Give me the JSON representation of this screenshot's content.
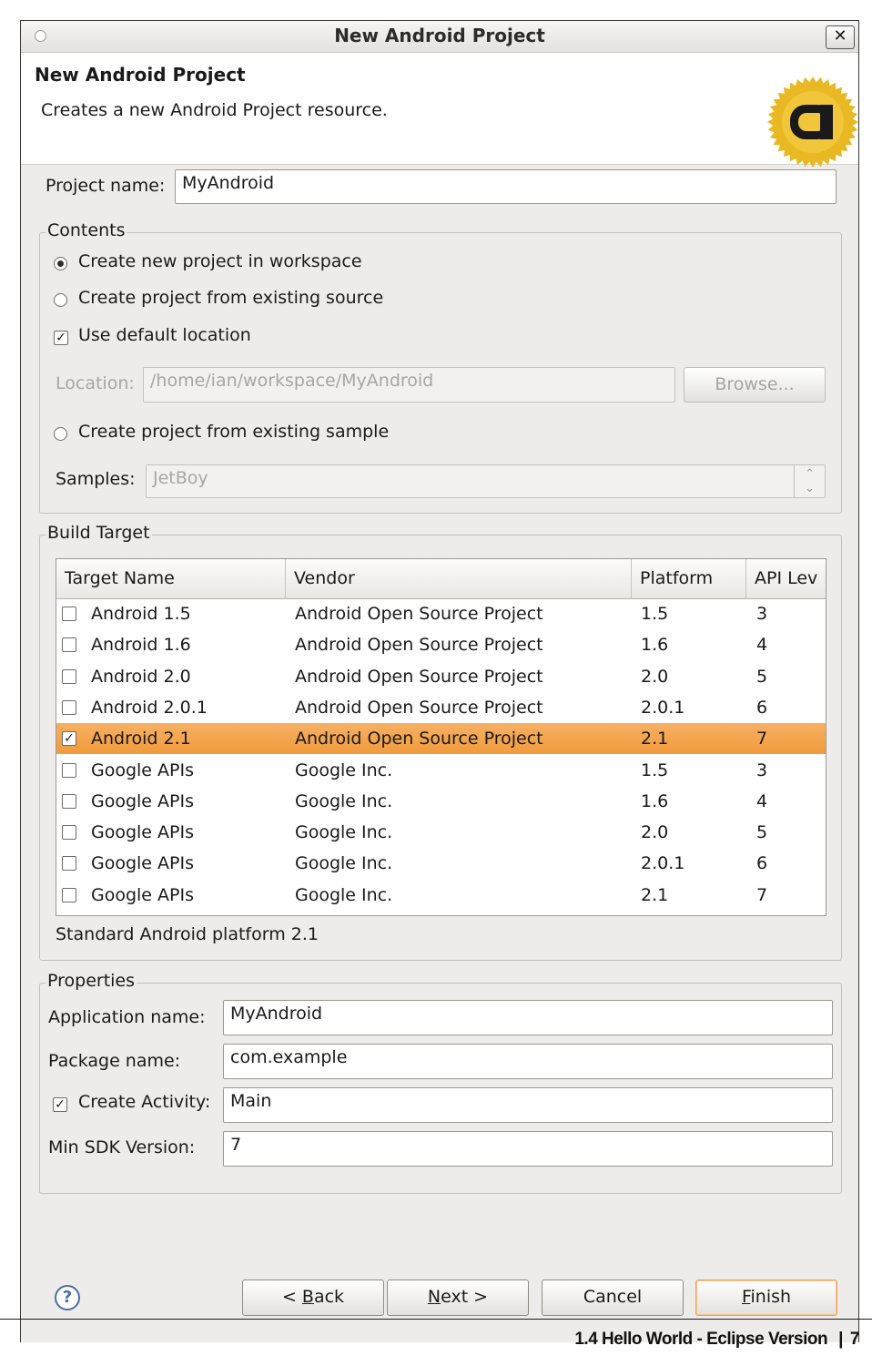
{
  "window": {
    "title": "New Android Project",
    "close_glyph": "✕"
  },
  "header": {
    "title": "New Android Project",
    "description": "Creates a new Android Project resource.",
    "logo_icon": "android-adt-badge-icon",
    "logo_colors": {
      "badge": "#e8b923",
      "glyph": "#1a1a1a"
    }
  },
  "project_name": {
    "label": "Project name:",
    "value": "MyAndroid"
  },
  "contents": {
    "title": "Contents",
    "create_new": "Create new project in workspace",
    "from_existing_source": "Create project from existing source",
    "use_default_location": "Use default location",
    "location_label": "Location:",
    "location_value": "/home/ian/workspace/MyAndroid",
    "browse_label": "Browse...",
    "from_existing_sample": "Create project from existing sample",
    "samples_label": "Samples:",
    "samples_value": "JetBoy",
    "selected_option": "create_new",
    "use_default_location_checked": true
  },
  "build_target": {
    "title": "Build Target",
    "columns": [
      "Target Name",
      "Vendor",
      "Platform",
      "API Lev"
    ],
    "rows": [
      {
        "name": "Android 1.5",
        "vendor": "Android Open Source Project",
        "platform": "1.5",
        "api": "3",
        "checked": false
      },
      {
        "name": "Android 1.6",
        "vendor": "Android Open Source Project",
        "platform": "1.6",
        "api": "4",
        "checked": false
      },
      {
        "name": "Android 2.0",
        "vendor": "Android Open Source Project",
        "platform": "2.0",
        "api": "5",
        "checked": false
      },
      {
        "name": "Android 2.0.1",
        "vendor": "Android Open Source Project",
        "platform": "2.0.1",
        "api": "6",
        "checked": false
      },
      {
        "name": "Android 2.1",
        "vendor": "Android Open Source Project",
        "platform": "2.1",
        "api": "7",
        "checked": true
      },
      {
        "name": "Google APIs",
        "vendor": "Google Inc.",
        "platform": "1.5",
        "api": "3",
        "checked": false
      },
      {
        "name": "Google APIs",
        "vendor": "Google Inc.",
        "platform": "1.6",
        "api": "4",
        "checked": false
      },
      {
        "name": "Google APIs",
        "vendor": "Google Inc.",
        "platform": "2.0",
        "api": "5",
        "checked": false
      },
      {
        "name": "Google APIs",
        "vendor": "Google Inc.",
        "platform": "2.0.1",
        "api": "6",
        "checked": false
      },
      {
        "name": "Google APIs",
        "vendor": "Google Inc.",
        "platform": "2.1",
        "api": "7",
        "checked": false
      }
    ],
    "description": "Standard Android platform 2.1",
    "selection_color": "#f3a64f"
  },
  "properties": {
    "title": "Properties",
    "app_name_label": "Application name:",
    "app_name_value": "MyAndroid",
    "package_label": "Package name:",
    "package_value": "com.example",
    "create_activity_label": "Create Activity:",
    "create_activity_checked": true,
    "activity_value": "Main",
    "min_sdk_label": "Min SDK Version:",
    "min_sdk_value": "7"
  },
  "buttons": {
    "help": "?",
    "back_prefix": "< ",
    "back_mnemonic": "B",
    "back_rest": "ack",
    "next_mnemonic": "N",
    "next_rest": "ext >",
    "cancel": "Cancel",
    "finish_mnemonic": "F",
    "finish_rest": "inish"
  },
  "page_caption": {
    "section": "1.4  Hello World - Eclipse Version",
    "separator": "|",
    "page_number": "7"
  }
}
